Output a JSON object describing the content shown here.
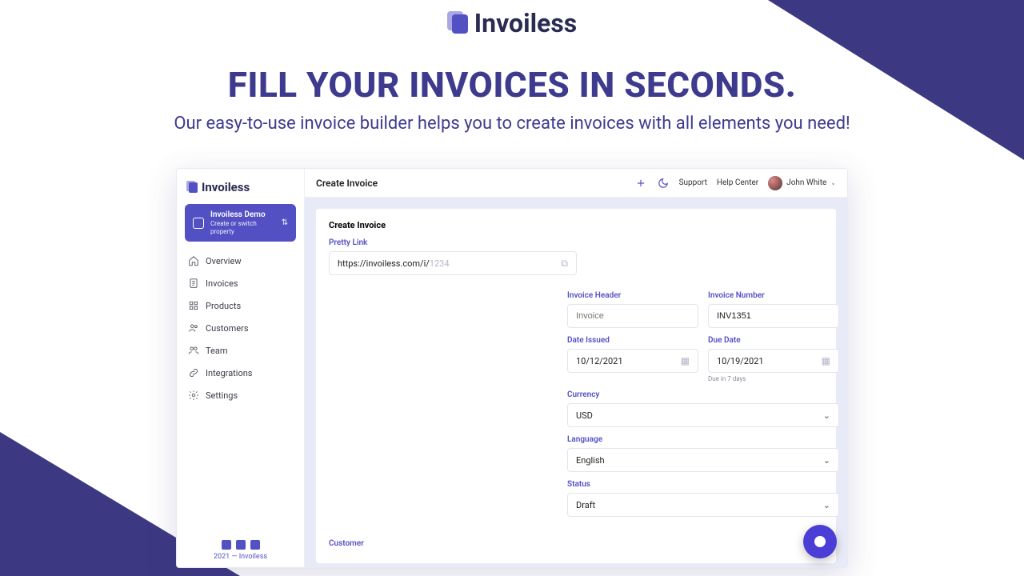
{
  "brand": "Invoiless",
  "hero": {
    "headline": "FILL YOUR INVOICES IN SECONDS.",
    "subhead": "Our easy-to-use invoice builder helps you to create invoices with all elements you need!"
  },
  "topbar": {
    "title": "Create Invoice",
    "support": "Support",
    "help": "Help Center",
    "user": "John White"
  },
  "switcher": {
    "title": "Invoiless Demo",
    "subtitle": "Create or switch property"
  },
  "nav": {
    "overview": "Overview",
    "invoices": "Invoices",
    "products": "Products",
    "customers": "Customers",
    "team": "Team",
    "integrations": "Integrations",
    "settings": "Settings"
  },
  "footer": "2021 — Invoiless",
  "form": {
    "section_title": "Create Invoice",
    "pretty_link_label": "Pretty Link",
    "pretty_link_prefix": "https://invoiless.com/i/",
    "pretty_link_placeholder": "1234",
    "invoice_header_label": "Invoice Header",
    "invoice_header_placeholder": "Invoice",
    "invoice_number_label": "Invoice Number",
    "invoice_number_value": "INV1351",
    "date_issued_label": "Date Issued",
    "date_issued_value": "10/12/2021",
    "due_date_label": "Due Date",
    "due_date_value": "10/19/2021",
    "due_hint": "Due in 7 days",
    "currency_label": "Currency",
    "currency_value": "USD",
    "language_label": "Language",
    "language_value": "English",
    "status_label": "Status",
    "status_value": "Draft",
    "customer_label": "Customer"
  }
}
